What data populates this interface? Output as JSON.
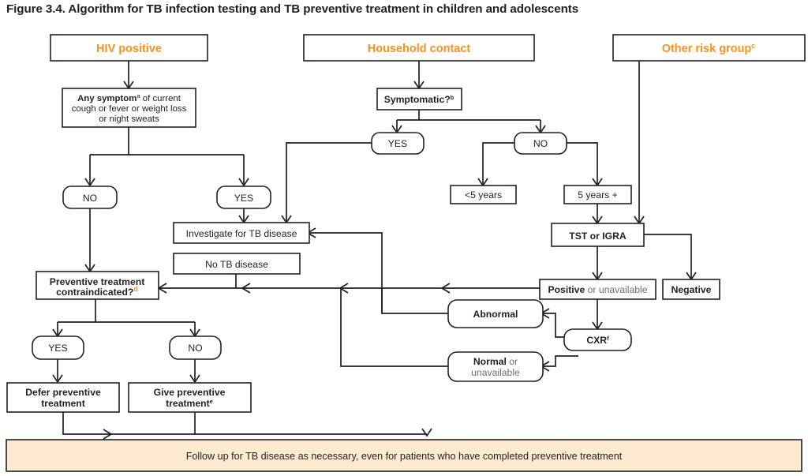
{
  "figure": {
    "caption": "Figure 3.4. Algorithm for TB infection testing and TB preventive treatment in children and adolescents",
    "accent_color": "#f6921e",
    "line_color": "#231f20",
    "footer_fill": "#fdead0"
  },
  "entry_points": [
    {
      "id": "hiv-positive",
      "label": "HIV positive"
    },
    {
      "id": "household-contact",
      "label": "Household contact"
    },
    {
      "id": "other-risk-group",
      "label": "Other risk group",
      "superscript": "c"
    }
  ],
  "nodes": {
    "any_symptom": {
      "line1_bold": "Any symptom",
      "line1_sup": "a",
      "line1_rest": " of current",
      "line2": "cough or fever or weight loss",
      "line3": "or night sweats"
    },
    "symptomatic": {
      "label": "Symptomatic?",
      "superscript": "b"
    },
    "hiv_no": {
      "label": "NO"
    },
    "hiv_yes": {
      "label": "YES"
    },
    "hc_yes": {
      "label": "YES"
    },
    "hc_no": {
      "label": "NO"
    },
    "under5": {
      "label": "<5 years"
    },
    "over5": {
      "label": "5 years +"
    },
    "tst_igra": {
      "label": "TST or IGRA"
    },
    "positive": {
      "label_bold": "Positive",
      "label_rest": " or unavailable"
    },
    "negative": {
      "label": "Negative"
    },
    "cxr": {
      "label": "CXR",
      "superscript": "f"
    },
    "abnormal": {
      "label": "Abnormal"
    },
    "normal": {
      "label_bold": "Normal",
      "label_rest": " or",
      "line2": "unavailable"
    },
    "investigate": {
      "label": "Investigate for TB disease"
    },
    "no_tb_disease": {
      "label": "No TB disease"
    },
    "contraindicated": {
      "line1": "Preventive treatment",
      "line2": "contraindicated?",
      "superscript": "d"
    },
    "ct_yes": {
      "label": "YES"
    },
    "ct_no": {
      "label": "NO"
    },
    "defer": {
      "line1": "Defer preventive",
      "line2": "treatment"
    },
    "give": {
      "line1": "Give preventive",
      "line2": "treatment",
      "superscript": "e"
    },
    "follow_up": {
      "label": "Follow up for TB disease as necessary, even for patients who have completed preventive treatment"
    }
  }
}
